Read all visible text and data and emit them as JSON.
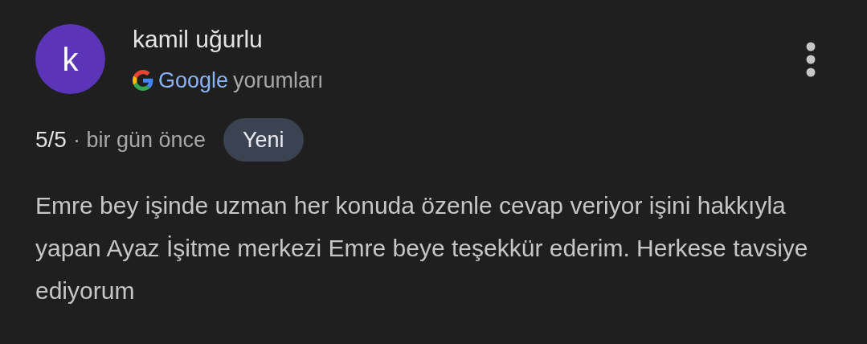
{
  "review": {
    "avatar_letter": "k",
    "author": "kamil uğurlu",
    "source_brand": "Google",
    "source_label": "yorumları",
    "rating": "5/5",
    "time": "· bir gün önce",
    "badge": "Yeni",
    "text": "Emre bey işinde uzman her konuda özenle cevap veriyor işini hakkıyla yapan Ayaz İşitme merkezi Emre beye teşekkür ederim. Herkese tavsiye ediyorum"
  }
}
